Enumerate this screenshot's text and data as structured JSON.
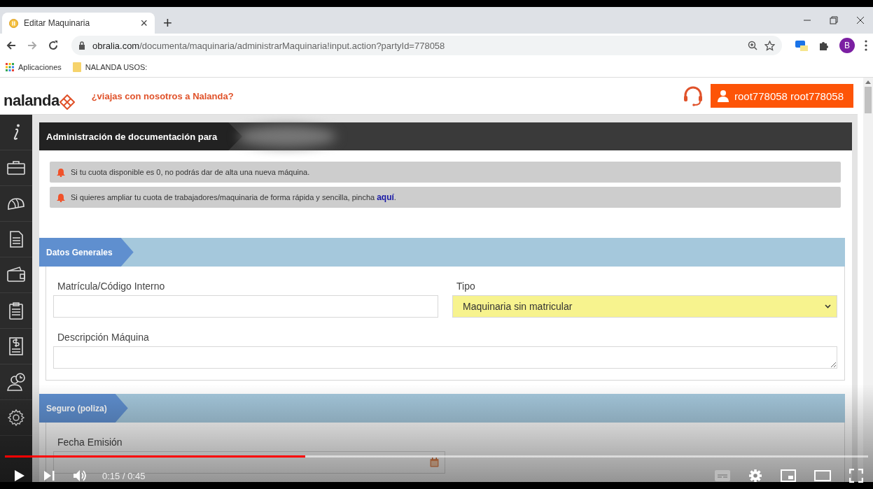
{
  "browser": {
    "tab_title": "Editar Maquinaria",
    "tab_close": "×",
    "new_tab": "+",
    "url_host": "obralia.com",
    "url_path": "/documenta/maquinaria/administrarMaquinaria!input.action?partyId=778058",
    "profile_initial": "B",
    "bookmarks": [
      {
        "label": "Aplicaciones",
        "kind": "apps"
      },
      {
        "label": "NALANDA USOS:",
        "kind": "folder"
      }
    ]
  },
  "site_header": {
    "logo": "nalanda",
    "tagline": "¿viajas con nosotros a Nalanda?",
    "user_button": "root778058 root778058"
  },
  "sidebar": {
    "items": [
      {
        "kind": "info"
      },
      {
        "kind": "briefcase"
      },
      {
        "kind": "helmet"
      },
      {
        "kind": "document"
      },
      {
        "kind": "wallet"
      },
      {
        "kind": "clipboard"
      },
      {
        "kind": "invoice"
      },
      {
        "kind": "worker"
      },
      {
        "kind": "gear"
      }
    ]
  },
  "page": {
    "title": "Administración de documentación para",
    "alerts": [
      {
        "text": "Si tu cuota disponible es 0, no podrás dar de alta una nueva máquina."
      },
      {
        "text": "Si quieres ampliar tu cuota de trabajadores/maquinaria de forma rápida y sencilla, pincha ",
        "link": "aquí",
        "end": "."
      }
    ],
    "sections": [
      {
        "title": "Datos Generales",
        "fields": [
          {
            "label": "Matrícula/Código Interno",
            "kind": "text"
          },
          {
            "label": "Tipo",
            "kind": "select",
            "value": "Maquinaria sin matricular"
          },
          {
            "label": "Descripción Máquina",
            "kind": "textarea"
          }
        ]
      },
      {
        "title": "Seguro (poliza)",
        "fields": [
          {
            "label": "Fecha Emisión",
            "kind": "date"
          }
        ]
      }
    ]
  },
  "video": {
    "level": 0.348,
    "time": "0:15 / 0:45"
  }
}
